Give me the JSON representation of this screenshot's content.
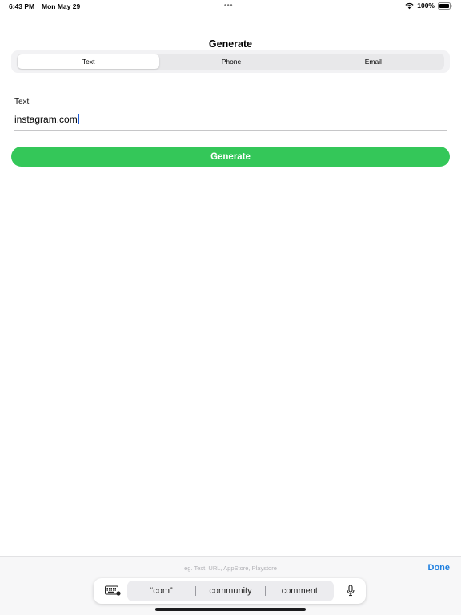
{
  "status_bar": {
    "time": "6:43 PM",
    "date": "Mon May 29",
    "dots": "•••",
    "battery": "100%"
  },
  "title": "Generate",
  "segments": [
    {
      "label": "Text",
      "selected": true
    },
    {
      "label": "Phone",
      "selected": false
    },
    {
      "label": "Email",
      "selected": false
    }
  ],
  "form": {
    "label": "Text",
    "value": "instagram.com"
  },
  "generate_button": "Generate",
  "accessory": {
    "placeholder": "eg. Text, URL, AppStore, Playstore",
    "done_label": "Done"
  },
  "predictive": {
    "suggestions": [
      "“com”",
      "community",
      "comment"
    ]
  },
  "colors": {
    "accent_green": "#34c759",
    "link_blue": "#1e7fe0",
    "caret_blue": "#1e5bd6"
  },
  "icons": {
    "wifi": "wifi-icon",
    "battery": "battery-icon",
    "keyboard": "keyboard-icon",
    "mic": "microphone-icon"
  }
}
